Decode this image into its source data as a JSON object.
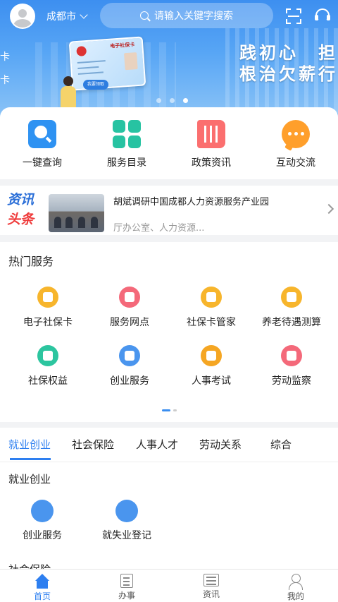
{
  "topbar": {
    "city": "成都市",
    "search_placeholder": "请输入关键字搜索"
  },
  "banner": {
    "slogan_line1": "践初心　担",
    "slogan_line2": "根治欠薪行",
    "left_text_1": "卡",
    "left_text_2": "卡",
    "card_title": "电子社保卡",
    "card_button": "我要领取",
    "slide_count": 3,
    "active_slide": 3
  },
  "quick_menu": [
    {
      "label": "一键查询",
      "icon": "search-icon",
      "color": "#2e92f2"
    },
    {
      "label": "服务目录",
      "icon": "grid-icon",
      "color": "#27c3a2"
    },
    {
      "label": "政策资讯",
      "icon": "book-icon",
      "color": "#fb6f6f"
    },
    {
      "label": "互动交流",
      "icon": "chat-icon",
      "color": "#ff9f2b"
    }
  ],
  "news": {
    "tag_line1": "资讯",
    "tag_line2": "头条",
    "title": "胡斌调研中国成都人力资源服务产业园",
    "subtitle": "厅办公室、人力资源..."
  },
  "hot_services": {
    "title": "热门服务",
    "items": [
      {
        "label": "电子社保卡",
        "icon": "id-card-icon",
        "color": "#f7b52c"
      },
      {
        "label": "服务网点",
        "icon": "location-icon",
        "color": "#f4697a"
      },
      {
        "label": "社保卡管家",
        "icon": "card-manager-icon",
        "color": "#f7b52c"
      },
      {
        "label": "养老待遇测算",
        "icon": "box-icon",
        "color": "#f7b52c"
      },
      {
        "label": "社保权益",
        "icon": "shield-icon",
        "color": "#2cc59f"
      },
      {
        "label": "创业服务",
        "icon": "tie-icon",
        "color": "#4a95ee"
      },
      {
        "label": "人事考试",
        "icon": "exam-icon",
        "color": "#f5a623"
      },
      {
        "label": "劳动监察",
        "icon": "inspect-icon",
        "color": "#f4697a"
      }
    ],
    "page_count": 2,
    "active_page": 1
  },
  "tabs": {
    "items": [
      "就业创业",
      "社会保险",
      "人事人才",
      "劳动关系",
      "综合"
    ],
    "active": 0
  },
  "section": {
    "title": "就业创业",
    "items": [
      {
        "label": "创业服务",
        "icon": "tie-icon",
        "color": "#4a95ee"
      },
      {
        "label": "就失业登记",
        "icon": "briefcase-icon",
        "color": "#4a95ee"
      }
    ],
    "next_title": "社会保险"
  },
  "bottom_nav": [
    {
      "label": "首页",
      "icon": "home-icon",
      "active": true
    },
    {
      "label": "办事",
      "icon": "document-icon",
      "active": false
    },
    {
      "label": "资讯",
      "icon": "news-icon",
      "active": false
    },
    {
      "label": "我的",
      "icon": "profile-icon",
      "active": false
    }
  ],
  "colors": {
    "accent": "#2e7ff0",
    "banner_top": "#3d8ff0"
  }
}
